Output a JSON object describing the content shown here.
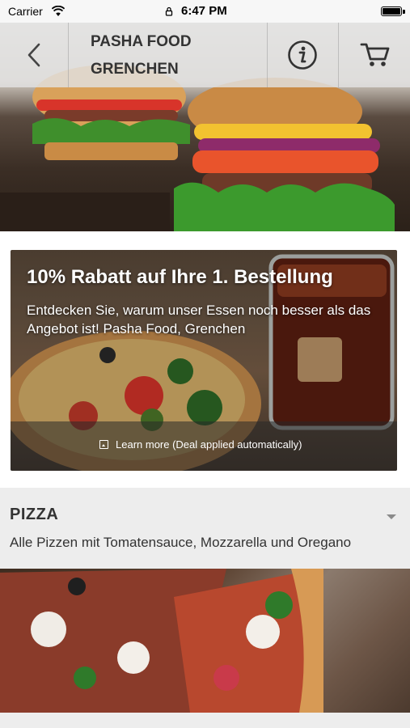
{
  "status_bar": {
    "carrier": "Carrier",
    "time": "6:47 PM"
  },
  "header": {
    "title_line1": "PASHA FOOD",
    "title_line2": "GRENCHEN",
    "back_icon": "chevron-left-icon",
    "info_icon": "info-icon",
    "cart_icon": "cart-icon"
  },
  "promo": {
    "title": "10% Rabatt auf Ihre 1. Bestellung",
    "description": "Entdecken Sie, warum unser Essen noch besser als das Angebot ist! Pasha Food, Grenchen",
    "learn_more": "Learn more (Deal applied automatically)"
  },
  "category": {
    "name": "PIZZA",
    "description": "Alle Pizzen mit Tomatensauce, Mozzarella und Oregano"
  },
  "colors": {
    "header_bg": "#e2e2e2",
    "category_bg": "#ededed",
    "text_dark": "#333333"
  }
}
